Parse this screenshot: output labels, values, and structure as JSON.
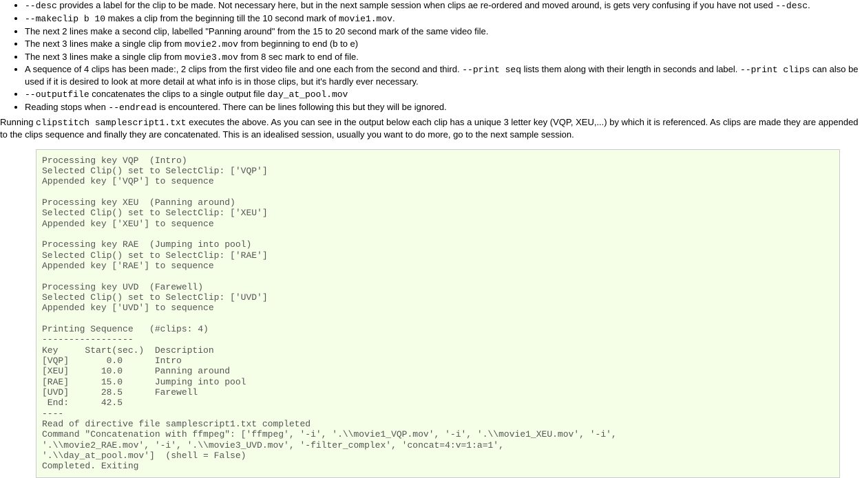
{
  "bullets": [
    {
      "parts": [
        {
          "t": "code",
          "v": "--desc"
        },
        {
          "t": "text",
          "v": " provides a label for the clip to be made. Not necessary here, but in the next sample session when clips ae re-ordered and moved around, is gets very confusing if you have not used "
        },
        {
          "t": "code",
          "v": "--desc"
        },
        {
          "t": "text",
          "v": "."
        }
      ]
    },
    {
      "parts": [
        {
          "t": "code",
          "v": "--makeclip b 10"
        },
        {
          "t": "text",
          "v": " makes a clip from the beginning till the 10 second mark of "
        },
        {
          "t": "code",
          "v": "movie1.mov"
        },
        {
          "t": "text",
          "v": "."
        }
      ]
    },
    {
      "parts": [
        {
          "t": "text",
          "v": "The next 2 lines make a second clip, labelled \"Panning around\" from the 15 to 20 second mark of the same video file."
        }
      ]
    },
    {
      "parts": [
        {
          "t": "text",
          "v": "The next 3 lines make a single clip from "
        },
        {
          "t": "code",
          "v": "movie2.mov"
        },
        {
          "t": "text",
          "v": " from beginning to end (b to e)"
        }
      ]
    },
    {
      "parts": [
        {
          "t": "text",
          "v": "The next 3 lines make a single clip from "
        },
        {
          "t": "code",
          "v": "movie3.mov"
        },
        {
          "t": "text",
          "v": " from 8 sec mark to end of file."
        }
      ]
    },
    {
      "parts": [
        {
          "t": "text",
          "v": "A sequence of 4 clips has been made:, 2 clips from the first video file and one each from the second and third. "
        },
        {
          "t": "code",
          "v": "--print seq"
        },
        {
          "t": "text",
          "v": " lists them along with their length in seconds and label. "
        },
        {
          "t": "code",
          "v": "--print clips"
        },
        {
          "t": "text",
          "v": " can also be used if it is desired to look at more detail at what info is in those clips, but it's hardly ever necessary."
        }
      ]
    },
    {
      "parts": [
        {
          "t": "code",
          "v": "--outputfile"
        },
        {
          "t": "text",
          "v": " concatenates the clips to a single output file "
        },
        {
          "t": "code",
          "v": "day_at_pool.mov"
        }
      ]
    },
    {
      "parts": [
        {
          "t": "text",
          "v": "Reading stops when "
        },
        {
          "t": "code",
          "v": "--endread"
        },
        {
          "t": "text",
          "v": " is encountered. There can be lines following this but they will be ignored."
        }
      ]
    }
  ],
  "paragraph": {
    "parts": [
      {
        "t": "text",
        "v": "Running "
      },
      {
        "t": "code",
        "v": "clipstitch samplescript1.txt"
      },
      {
        "t": "text",
        "v": " executes the above. As you can see in the output below each clip has a unique 3 letter key (VQP, XEU,...) by which it is referenced. As clips are made they are appended to the clips sequence and finally they are concatenated. This is an idealised session, usually you want to do more, go to the next sample session."
      }
    ]
  },
  "output": "Processing key VQP  (Intro)\nSelected Clip() set to SelectClip: ['VQP']\nAppended key ['VQP'] to sequence\n\nProcessing key XEU  (Panning around)\nSelected Clip() set to SelectClip: ['XEU']\nAppended key ['XEU'] to sequence\n\nProcessing key RAE  (Jumping into pool)\nSelected Clip() set to SelectClip: ['RAE']\nAppended key ['RAE'] to sequence\n\nProcessing key UVD  (Farewell)\nSelected Clip() set to SelectClip: ['UVD']\nAppended key ['UVD'] to sequence\n\nPrinting Sequence   (#clips: 4)\n-----------------\nKey     Start(sec.)  Description\n[VQP]       0.0      Intro\n[XEU]      10.0      Panning around\n[RAE]      15.0      Jumping into pool\n[UVD]      28.5      Farewell\n End:      42.5\n----\nRead of directive file samplescript1.txt completed\nCommand \"Concatenation with ffmpeg\": ['ffmpeg', '-i', '.\\\\movie1_VQP.mov', '-i', '.\\\\movie1_XEU.mov', '-i',\n'.\\\\movie2_RAE.mov', '-i', '.\\\\movie3_UVD.mov', '-filter_complex', 'concat=4:v=1:a=1',\n'.\\\\day_at_pool.mov']  (shell = False)\nCompleted. Exiting"
}
